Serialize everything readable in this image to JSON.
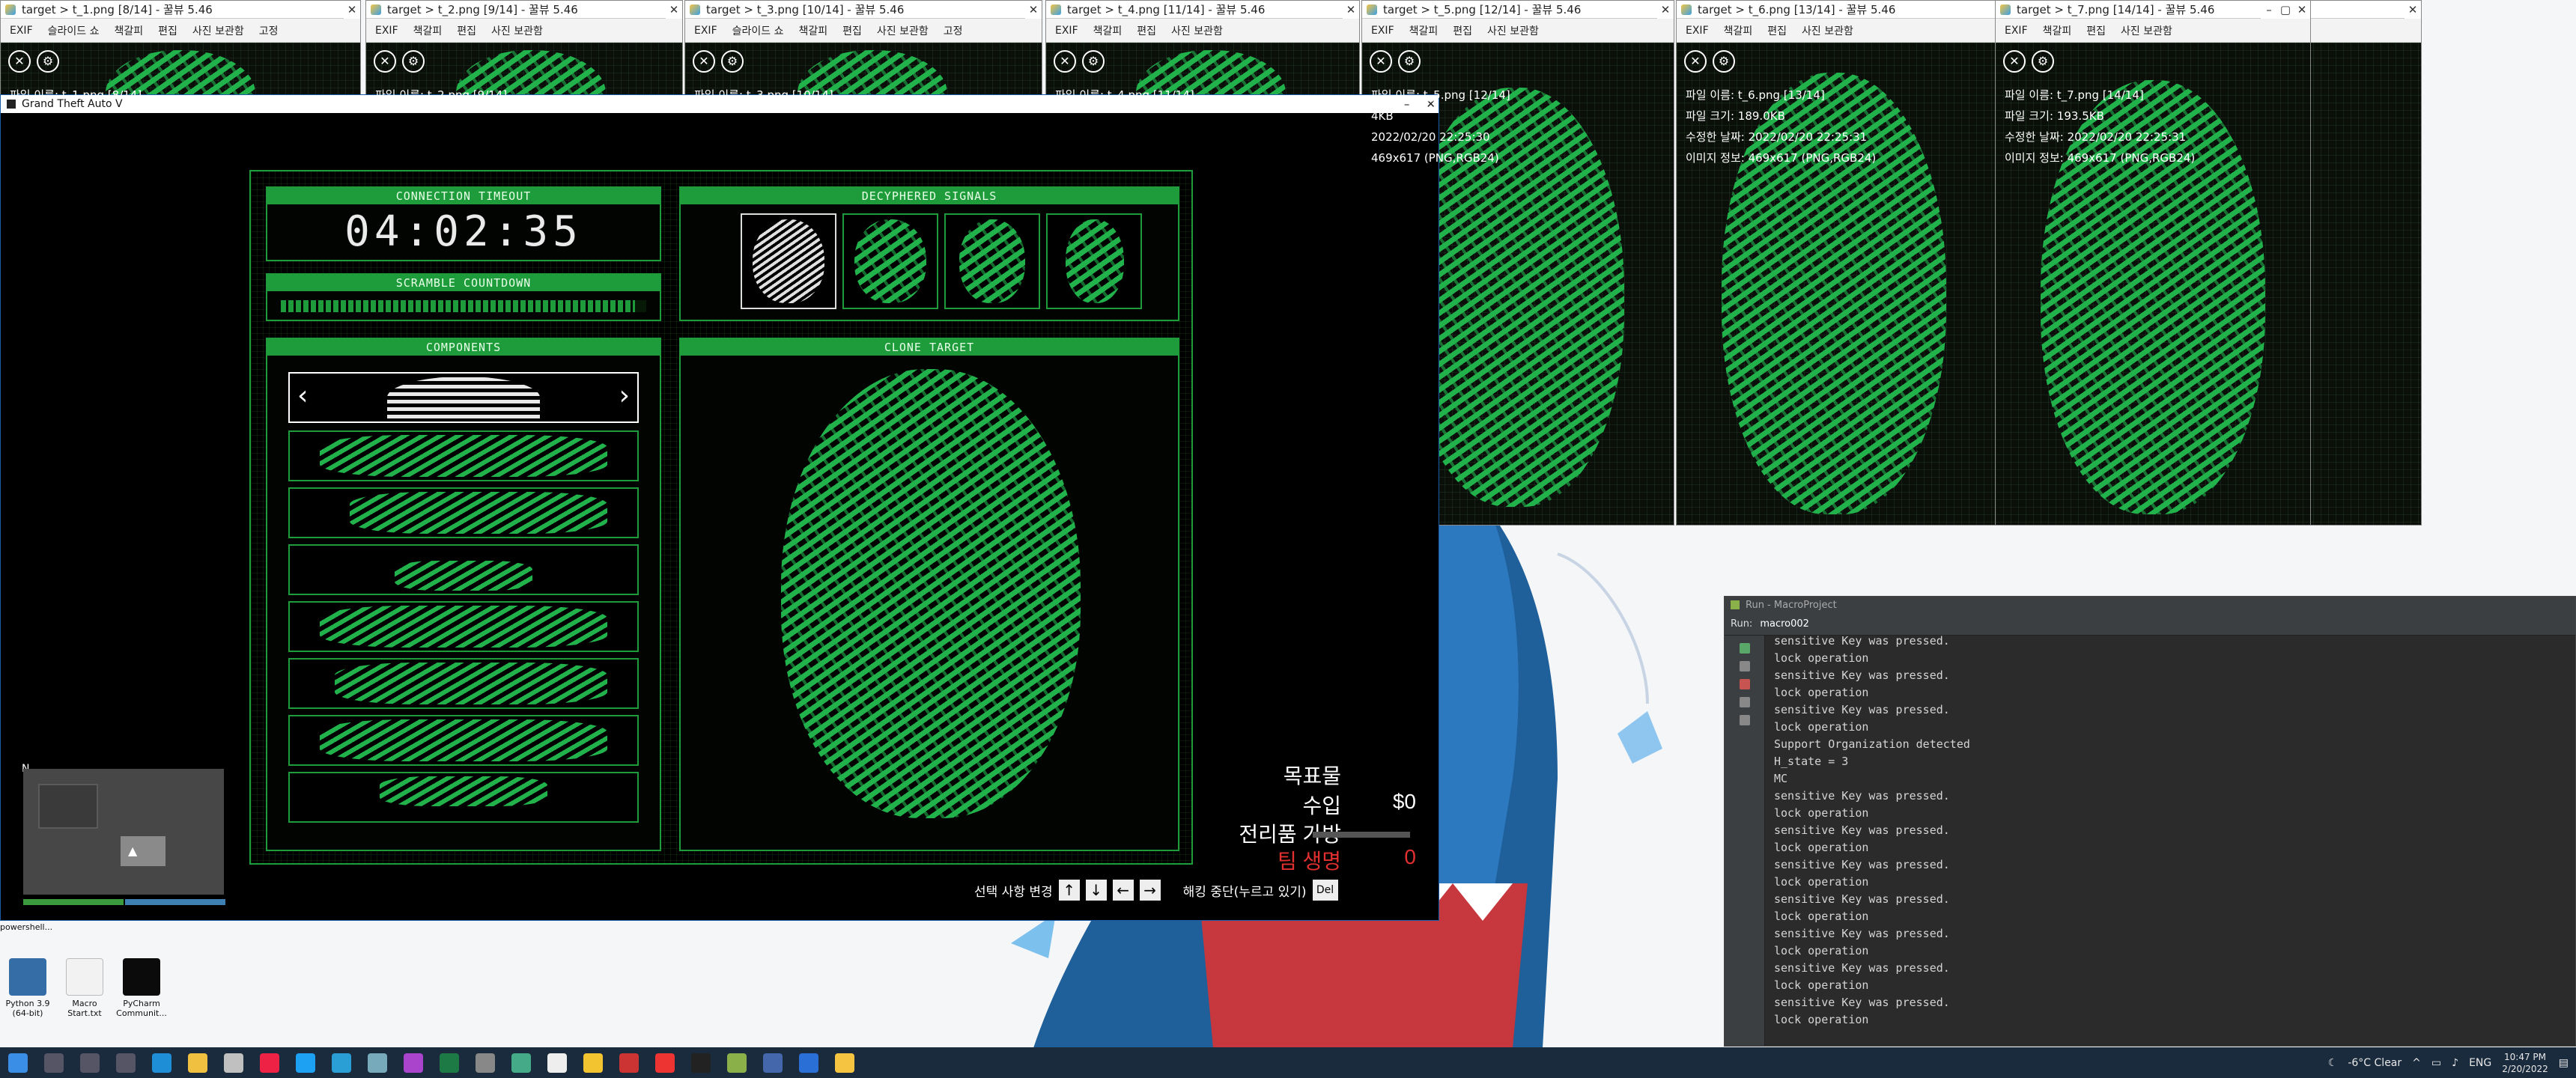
{
  "viewers": [
    {
      "title": "target > t_1.png [8/14] - 꿀뷰 5.46",
      "info": [
        "파일 이름: t_1.png [8/14]"
      ]
    },
    {
      "title": "target > t_2.png [9/14] - 꿀뷰 5.46",
      "info": [
        "파일 이름: t_2.png [9/14]"
      ]
    },
    {
      "title": "target > t_3.png [10/14] - 꿀뷰 5.46",
      "info": [
        "파일 이름: t_3.png [10/14]"
      ]
    },
    {
      "title": "target > t_4.png [11/14] - 꿀뷰 5.46",
      "info": [
        "파일 이름: t_4.png [11/14]"
      ]
    },
    {
      "title": "target > t_5.png [12/14] - 꿀뷰 5.46",
      "info": [
        "파일 이름: t_5.png [12/14]",
        "4KB",
        "2022/02/20 22:25:30",
        "469x617 (PNG,RGB24)"
      ]
    },
    {
      "title": "target > t_6.png [13/14] - 꿀뷰 5.46",
      "info": [
        "파일 이름: t_6.png [13/14]",
        "파일 크기: 189.0KB",
        "수정한 날짜: 2022/02/20 22:25:31",
        "이미지 정보: 469x617 (PNG,RGB24)"
      ]
    },
    {
      "title": "target > t_7.png [14/14] - 꿀뷰 5.46",
      "info": [
        "파일 이름: t_7.png [14/14]",
        "파일 크기: 193.5KB",
        "수정한 날짜: 2022/02/20 22:25:31",
        "이미지 정보: 469x617 (PNG,RGB24)"
      ]
    }
  ],
  "viewer_menu": [
    "EXIF",
    "슬라이드 쇼",
    "책갈피",
    "편집",
    "사진 보관함",
    "고정"
  ],
  "gta": {
    "window_title": "Grand Theft Auto V",
    "panels": {
      "timeout_title": "CONNECTION TIMEOUT",
      "timer": "04:02:35",
      "scramble_title": "SCRAMBLE COUNTDOWN",
      "signals_title": "DECYPHERED SIGNALS",
      "components_title": "COMPONENTS",
      "clone_title": "CLONE TARGET",
      "left_arrow": "‹",
      "right_arrow": "›"
    },
    "scramble_fill": 0.97,
    "hud": {
      "target_label": "목표물",
      "income_label": "수입",
      "income_value": "$0",
      "loot_label": "전리품 가방",
      "team_lives_label": "팀 생명",
      "team_lives_value": "0",
      "change_hint": "선택 사항 변경",
      "quit_hint": "해킹 중단(누르고 있기)",
      "del_key": "Del",
      "keys": [
        "↑",
        "↓",
        "←",
        "→"
      ]
    },
    "minimap_north": "N"
  },
  "run_window": {
    "title": "Run - MacroProject",
    "run_label": "Run:",
    "tab": "macro002",
    "console_lines": [
      "sensitive Key was pressed.",
      "lock operation",
      "sensitive Key was pressed.",
      "lock operation",
      "sensitive Key was pressed.",
      "lock operation",
      "Support Organization detected",
      "H_state = 3",
      "MC",
      "sensitive Key was pressed.",
      "lock operation",
      "sensitive Key was pressed.",
      "lock operation",
      "sensitive Key was pressed.",
      "lock operation",
      "sensitive Key was pressed.",
      "lock operation",
      "sensitive Key was pressed.",
      "lock operation",
      "sensitive Key was pressed.",
      "lock operation",
      "sensitive Key was pressed.",
      "lock operation"
    ]
  },
  "desktop_icons": [
    {
      "label": "powershell...",
      "color": "#2a5aa8"
    },
    {
      "label": "Python 3.9 (64-bit)",
      "color": "#356da6"
    },
    {
      "label": "Macro Start.txt",
      "color": "#f2f2f2"
    },
    {
      "label": "PyCharm Communit...",
      "color": "#0b0b0b"
    }
  ],
  "taskbar": {
    "weather": "-6°C  Clear",
    "lang": "ENG",
    "time": "10:47 PM",
    "date": "2/20/2022"
  }
}
